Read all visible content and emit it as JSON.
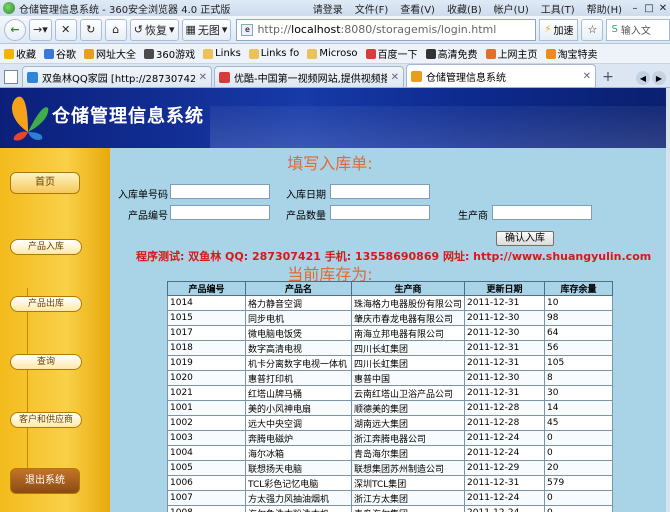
{
  "browser": {
    "title": "仓储管理信息系统 - 360安全浏览器 4.0 正式版",
    "menu": [
      "请登录",
      "文件(F)",
      "查看(V)",
      "收藏(B)",
      "帐户(U)",
      "工具(T)",
      "帮助(H)"
    ],
    "nav": {
      "restore_label": "恢复",
      "noimage_label": "无图",
      "url_prefix": "http://",
      "url_host": "localhost",
      "url_rest": ":8080/storagemis/login.html",
      "accel_label": "加速",
      "search_placeholder": "输入文"
    },
    "favorites": [
      "收藏",
      "谷歌",
      "网址大全",
      "360游戏",
      "Links",
      "Links fo",
      "Microso",
      "百度一下",
      "高清免费",
      "上网主页",
      "淘宝特卖"
    ],
    "tabs": [
      {
        "label": "双鱼林QQ家园 [http://287307421.q...",
        "active": false,
        "color": "#2f86d8"
      },
      {
        "label": "优酷-中国第一视频网站,提供视频播...",
        "active": false,
        "color": "#d93b3b"
      },
      {
        "label": "仓储管理信息系统",
        "active": true,
        "color": "#e8a01c"
      }
    ]
  },
  "page": {
    "system_title": "仓储管理信息系统",
    "sidebar": {
      "home": "首页",
      "items": [
        "产品入库",
        "产品出库",
        "查询",
        "客户和供应商"
      ],
      "exit": "退出系统"
    },
    "form": {
      "title": "填写入库单:",
      "order_no_label": "入库单号码",
      "order_no_value": "",
      "date_label": "入库日期",
      "date_value": "",
      "product_no_label": "产品编号",
      "product_no_value": "",
      "quantity_label": "产品数量",
      "quantity_value": "",
      "maker_label": "生产商",
      "maker_value": "",
      "submit_label": "确认入库"
    },
    "contact_text": "程序测试: 双鱼林  QQ: 287307421  手机: 13558690869   网址: http://www.shuangyulin.com",
    "stock": {
      "title": "当前库存为:",
      "columns": [
        "产品编号",
        "产品名",
        "生产商",
        "更新日期",
        "库存余量"
      ],
      "rows": [
        [
          "1014",
          "格力静音空调",
          "珠海格力电器股份有限公司",
          "2011-12-31",
          "10"
        ],
        [
          "1015",
          "同步电机",
          "肇庆市春龙电器有限公司",
          "2011-12-30",
          "98"
        ],
        [
          "1017",
          "微电脑电饭煲",
          "南海立邦电器有限公司",
          "2011-12-30",
          "64"
        ],
        [
          "1018",
          "数字高清电视",
          "四川长虹集团",
          "2011-12-31",
          "56"
        ],
        [
          "1019",
          "机卡分离数字电视一体机",
          "四川长虹集团",
          "2011-12-31",
          "105"
        ],
        [
          "1020",
          "惠普打印机",
          "惠普中国",
          "2011-12-30",
          "8"
        ],
        [
          "1021",
          "红塔山牌马桶",
          "云南红塔山卫浴产品公司",
          "2011-12-31",
          "30"
        ],
        [
          "1001",
          "美的小风神电扇",
          "顺德美的集团",
          "2011-12-28",
          "14"
        ],
        [
          "1002",
          "远大中央空调",
          "湖南远大集团",
          "2011-12-28",
          "45"
        ],
        [
          "1003",
          "奔腾电磁炉",
          "浙江奔腾电器公司",
          "2011-12-24",
          "0"
        ],
        [
          "1004",
          "海尔冰箱",
          "青岛海尔集团",
          "2011-12-24",
          "0"
        ],
        [
          "1005",
          "联想扬天电脑",
          "联想集团苏州制造公司",
          "2011-12-29",
          "20"
        ],
        [
          "1006",
          "TCL彩色记忆电脑",
          "深圳TCL集团",
          "2011-12-31",
          "579"
        ],
        [
          "1007",
          "方太强力风抽油烟机",
          "浙江方太集团",
          "2011-12-24",
          "0"
        ],
        [
          "1008",
          "海尔免洗衣粉洗衣机",
          "青岛海尔集团",
          "2011-12-24",
          "0"
        ]
      ]
    }
  },
  "colors": {
    "page_bg": "#a9d3e6",
    "sidebar": "#f3bb1c",
    "banner": "#0b1f7a",
    "heading": "#e06a36",
    "contact": "#d81818"
  }
}
